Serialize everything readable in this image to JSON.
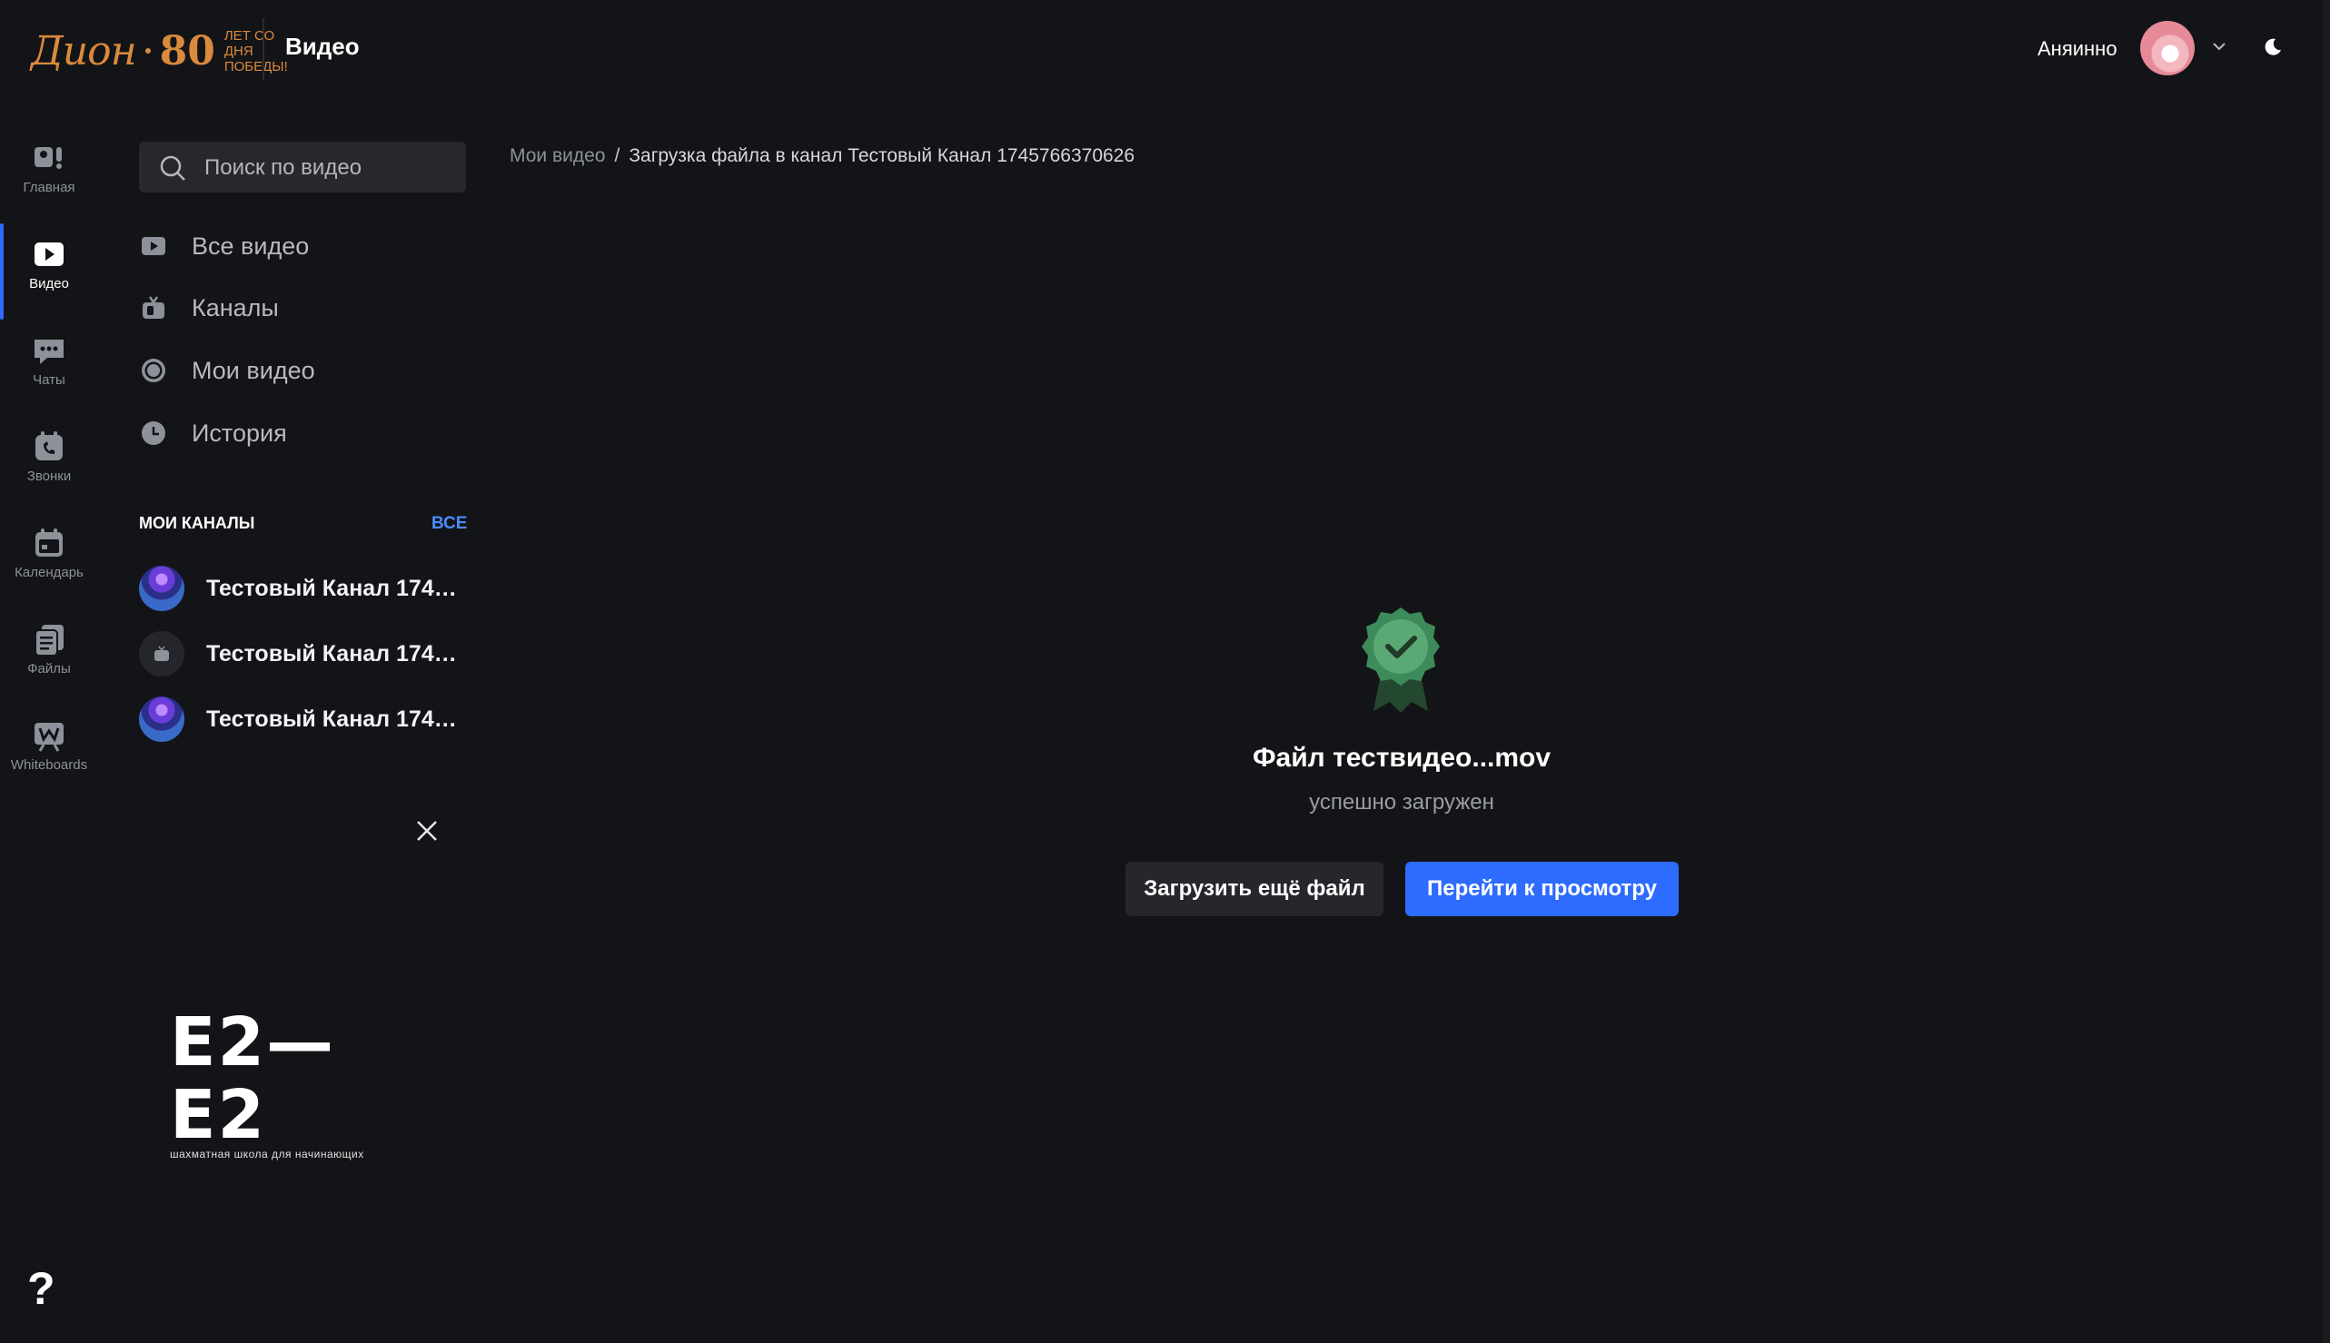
{
  "header": {
    "logo": {
      "script_text": "Дион",
      "number": "80",
      "note": "лет со дня победы!"
    },
    "section_title": "Видео",
    "user_name": "Аняинно"
  },
  "rail": {
    "items": [
      {
        "label": "Главная",
        "icon": "home-icon"
      },
      {
        "label": "Видео",
        "icon": "video-icon",
        "active": true
      },
      {
        "label": "Чаты",
        "icon": "chat-icon"
      },
      {
        "label": "Звонки",
        "icon": "calls-icon"
      },
      {
        "label": "Календарь",
        "icon": "calendar-icon"
      },
      {
        "label": "Файлы",
        "icon": "files-icon"
      },
      {
        "label": "Whiteboards",
        "icon": "whiteboard-icon"
      }
    ],
    "help": "?"
  },
  "sidebar": {
    "search_placeholder": "Поиск по видео",
    "nav": [
      {
        "label": "Все видео",
        "icon": "play-square-icon"
      },
      {
        "label": "Каналы",
        "icon": "tv-icon"
      },
      {
        "label": "Мои видео",
        "icon": "record-icon"
      },
      {
        "label": "История",
        "icon": "clock-icon"
      }
    ],
    "channels_heading": "МОИ КАНАЛЫ",
    "channels_all": "ВСЕ",
    "channels": [
      {
        "name": "Тестовый Канал 17457..."
      },
      {
        "name": "Тестовый Канал 17457..."
      },
      {
        "name": "Тестовый Канал 17457..."
      }
    ],
    "promo": {
      "big": "E2—E2",
      "small": "шахматная школа для начинающих"
    }
  },
  "breadcrumb": {
    "root": "Мои видео",
    "separator": "/",
    "current": "Загрузка файла в канал Тестовый Канал 1745766370626"
  },
  "upload_result": {
    "file_title": "Файл тествидео...mov",
    "status": "успешно загружен",
    "upload_more": "Загрузить ещё файл",
    "go_to_view": "Перейти к просмотру"
  },
  "colors": {
    "accent": "#2e6bff",
    "background": "#131417",
    "success": "#3d8a5a",
    "brand": "#d98a3d"
  }
}
